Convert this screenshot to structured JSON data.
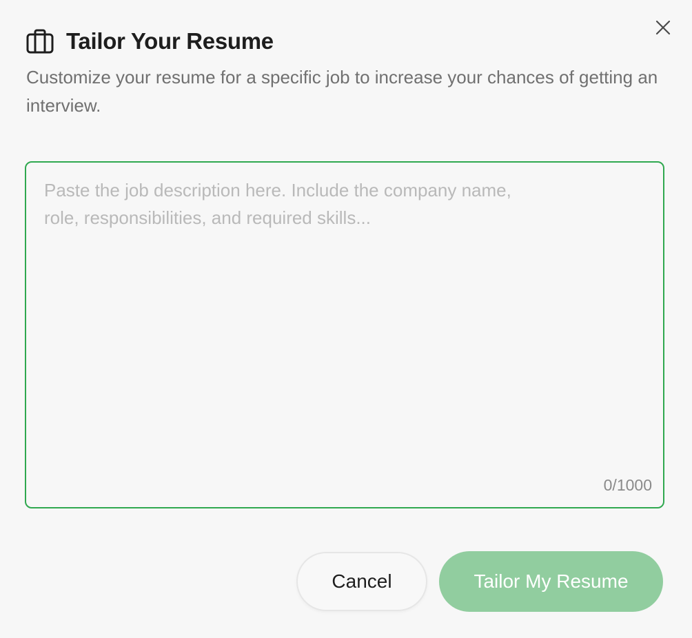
{
  "dialog": {
    "title": "Tailor Your Resume",
    "subtitle": "Customize your resume for a specific job to increase your chances of getting an interview.",
    "header_icon": "briefcase-icon",
    "close_icon": "close-icon"
  },
  "job_description": {
    "value": "",
    "placeholder": "Paste the job description here. Include the company name, role, responsibilities, and required skills...",
    "counter": "0/1000"
  },
  "actions": {
    "cancel_label": "Cancel",
    "submit_label": "Tailor My Resume"
  },
  "colors": {
    "accent": "#2fa84f",
    "primary_button_disabled": "#91cd9f",
    "subtitle_text": "#707070",
    "placeholder_text": "#b9b9b9"
  }
}
